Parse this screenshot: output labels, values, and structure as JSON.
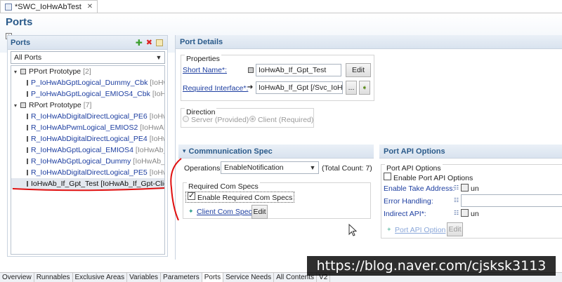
{
  "editor_tab": {
    "title": "*SWC_IoHwAbTest",
    "close": "✕"
  },
  "form": {
    "title": "Ports"
  },
  "ports_panel": {
    "title": "Ports",
    "filter_value": "All Ports",
    "tree": [
      {
        "level": 1,
        "name": "PPort Prototype",
        "type": "[2]",
        "twisty": "▾"
      },
      {
        "level": 2,
        "name": "P_IoHwAbGptLogical_Dummy_Cbk",
        "type": "[IoHw"
      },
      {
        "level": 2,
        "name": "P_IoHwAbGptLogical_EMIOS4_Cbk",
        "type": "[IoHw"
      },
      {
        "level": 1,
        "name": "RPort Prototype",
        "type": "[7]",
        "twisty": "▾"
      },
      {
        "level": 2,
        "name": "R_IoHwAbDigitalDirectLogical_PE6",
        "type": "[IoHwA"
      },
      {
        "level": 2,
        "name": "R_IoHwAbPwmLogical_EMIOS2",
        "type": "[IoHwAb_"
      },
      {
        "level": 2,
        "name": "R_IoHwAbDigitalDirectLogical_PE4",
        "type": "[IoHwA"
      },
      {
        "level": 2,
        "name": "R_IoHwAbGptLogical_EMIOS4",
        "type": "[IoHwAb_l"
      },
      {
        "level": 2,
        "name": "R_IoHwAbGptLogical_Dummy",
        "type": "[IoHwAb_I"
      },
      {
        "level": 2,
        "name": "R_IoHwAbDigitalDirectLogical_PE5",
        "type": "[IoHwA"
      },
      {
        "level": 2,
        "name": "IoHwAb_If_Gpt_Test",
        "type": "[IoHwAb_If_Gpt-Clie",
        "selected": true
      }
    ]
  },
  "port_details": {
    "title": "Port Details",
    "properties_label": "Properties",
    "short_name_label": "Short Name*:",
    "short_name_value": "IoHwAb_If_Gpt_Test",
    "edit_label": "Edit",
    "required_interface_label": "Required Interface*:",
    "required_interface_value": "IoHwAb_If_Gpt [/Svc_IoHw",
    "browse_label": "...",
    "direction_label": "Direction",
    "direction_options": [
      "Server (Provided)",
      "Client (Required)"
    ]
  },
  "comm_spec": {
    "title": "Commnunication Spec",
    "operations_label": "Operations",
    "operations_value": "EnableNotification",
    "total_count": "(Total Count: 7)",
    "required_com_specs_label": "Required Com Specs",
    "enable_label": "Enable Required Com Specs",
    "client_com_spec_label": "Client Com Spec",
    "edit_label": "Edit"
  },
  "port_api": {
    "title": "Port API Options",
    "group_label": "Port API Options",
    "enable_label": "Enable Port API Options",
    "take_address_label": "Enable Take Address:",
    "take_address_value": "un",
    "error_handling_label": "Error Handling:",
    "indirect_api_label": "Indirect API*:",
    "indirect_api_value": "un",
    "port_api_option_label": "Port API Option",
    "edit_label": "Edit"
  },
  "bottom_tabs": [
    "Overview",
    "Runnables",
    "Exclusive Areas",
    "Variables",
    "Parameters",
    "Ports",
    "Service Needs",
    "All Contents",
    "V2"
  ],
  "active_bottom_tab": "Ports",
  "watermark": "https://blog.naver.com/cjsksk3113",
  "colors": {
    "accent": "#2a5a8a",
    "link": "#1d3ea0",
    "annotation": "#e01010"
  }
}
